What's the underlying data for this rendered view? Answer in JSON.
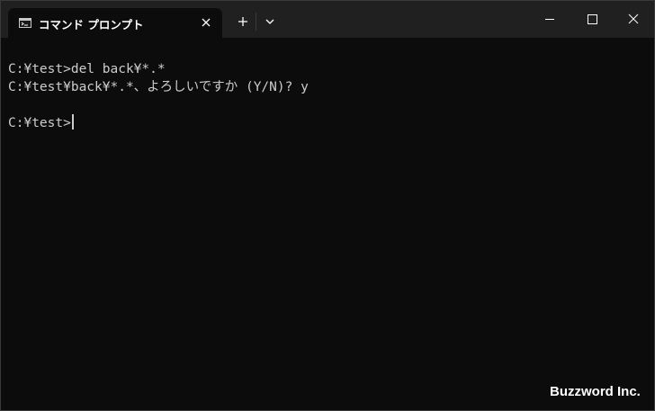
{
  "tab": {
    "title": "コマンド プロンプト",
    "icon": "terminal-icon"
  },
  "console": {
    "lines": [
      "C:¥test>del back¥*.*",
      "C:¥test¥back¥*.*、よろしいですか (Y/N)? y",
      "",
      "C:¥test>"
    ]
  },
  "watermark": "Buzzword Inc.",
  "colors": {
    "titlebar": "#202020",
    "background": "#0c0c0c",
    "text": "#cccccc"
  }
}
